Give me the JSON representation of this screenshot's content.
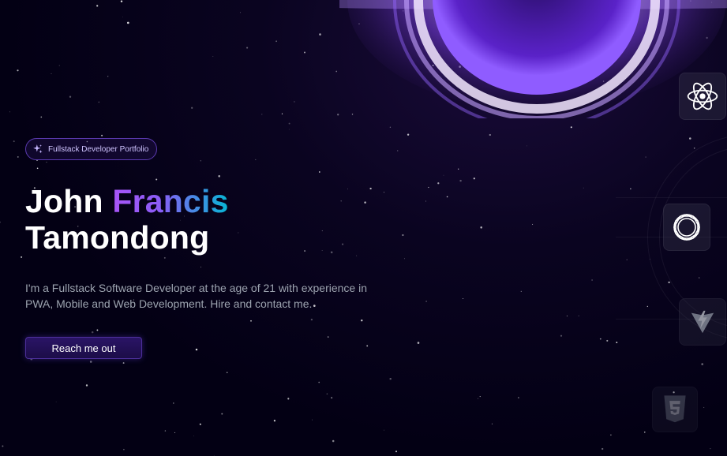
{
  "hero": {
    "badge_label": "Fullstack Developer Portfolio",
    "title_first": "John",
    "title_highlight": "Francis",
    "title_last": "Tamondong",
    "description": "I'm a Fullstack Software Developer at the age of 21 with experience in PWA, Mobile and Web Development. Hire and contact me.",
    "cta_label": "Reach me out"
  },
  "skills": [
    {
      "icon": "react-icon"
    },
    {
      "icon": "openai-ring-icon"
    },
    {
      "icon": "vite-icon"
    },
    {
      "icon": "css3-icon"
    }
  ],
  "colors": {
    "background": "#030014",
    "accent": "#7042f8",
    "gradient_start": "#a855f7",
    "gradient_end": "#06b6d4"
  }
}
